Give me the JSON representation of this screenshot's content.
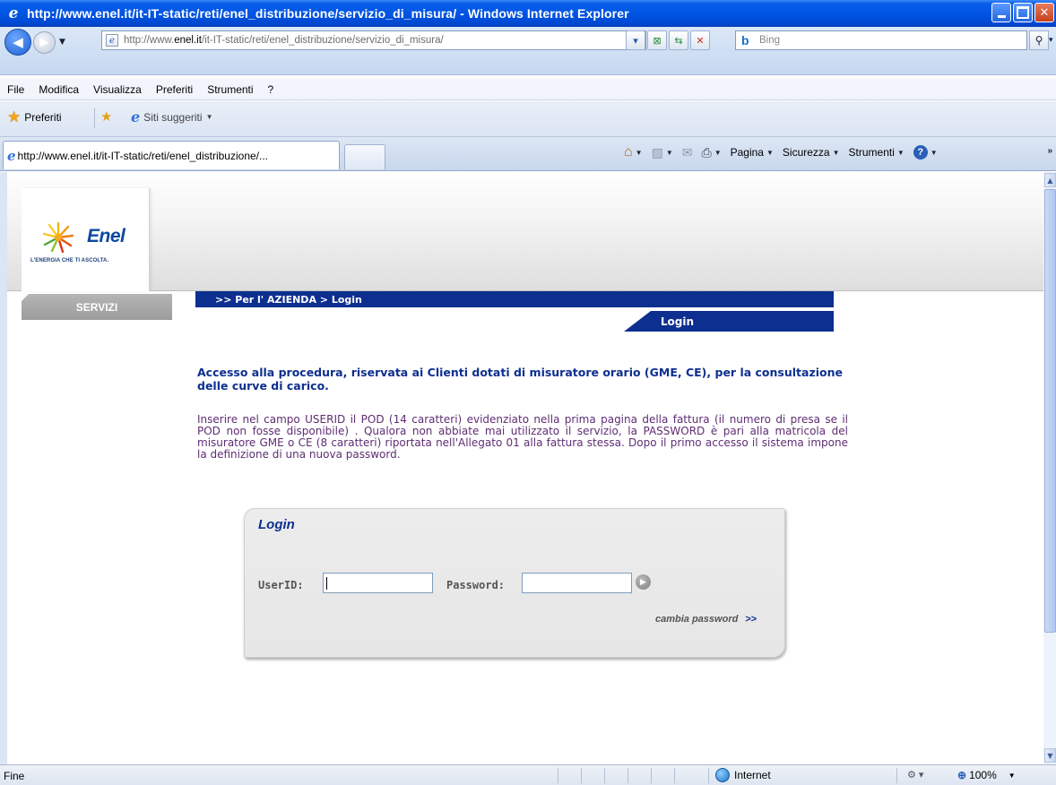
{
  "window": {
    "title": "http://www.enel.it/it-IT-static/reti/enel_distribuzione/servizio_di_misura/ - Windows Internet Explorer"
  },
  "address_bar": {
    "url_prefix": "http://www.",
    "url_domain": "enel.it",
    "url_path": "/it-IT-static/reti/enel_distribuzione/servizio_di_misura/",
    "search_placeholder": "Bing"
  },
  "menu": {
    "items": [
      "File",
      "Modifica",
      "Visualizza",
      "Preferiti",
      "Strumenti",
      "?"
    ]
  },
  "favorites_bar": {
    "favorites_label": "Preferiti",
    "suggested_label": "Siti suggeriti"
  },
  "tabs": [
    {
      "label": "http://www.enel.it/it-IT-static/reti/enel_distribuzione/..."
    }
  ],
  "command_bar": {
    "page_label": "Pagina",
    "security_label": "Sicurezza",
    "tools_label": "Strumenti"
  },
  "page": {
    "logo": {
      "wordmark": "Enel",
      "tagline": "L'ENERGIA CHE TI ASCOLTA."
    },
    "servizi_label": "SERVIZI",
    "breadcrumb": ">> Per l' AZIENDA > Login",
    "section_title": "Login",
    "intro_title": "Accesso alla procedura, riservata ai Clienti dotati di misuratore orario (GME, CE), per la consultazione delle curve di carico.",
    "intro_body": "Inserire nel campo USERID il POD (14 caratteri) evidenziato nella prima pagina della fattura (il numero di presa se il POD non fosse disponibile) . Qualora non abbiate mai utilizzato il servizio, la PASSWORD è pari alla matricola del misuratore GME o CE (8 caratteri) riportata nell'Allegato 01 alla fattura stessa. Dopo il primo accesso il sistema impone la definizione di una nuova password.",
    "login_box": {
      "title": "Login",
      "userid_label": "UserID:",
      "userid_value": "",
      "password_label": "Password:",
      "password_value": "",
      "change_password_label": "cambia password",
      "change_password_arrows": ">>"
    }
  },
  "status_bar": {
    "status_text": "Fine",
    "zone_label": "Internet",
    "zoom_label": "100%"
  },
  "colors": {
    "enel_blue": "#0d2f8f",
    "intro_body": "#5f2d73",
    "servizi_grey": "#a8a8a8"
  }
}
